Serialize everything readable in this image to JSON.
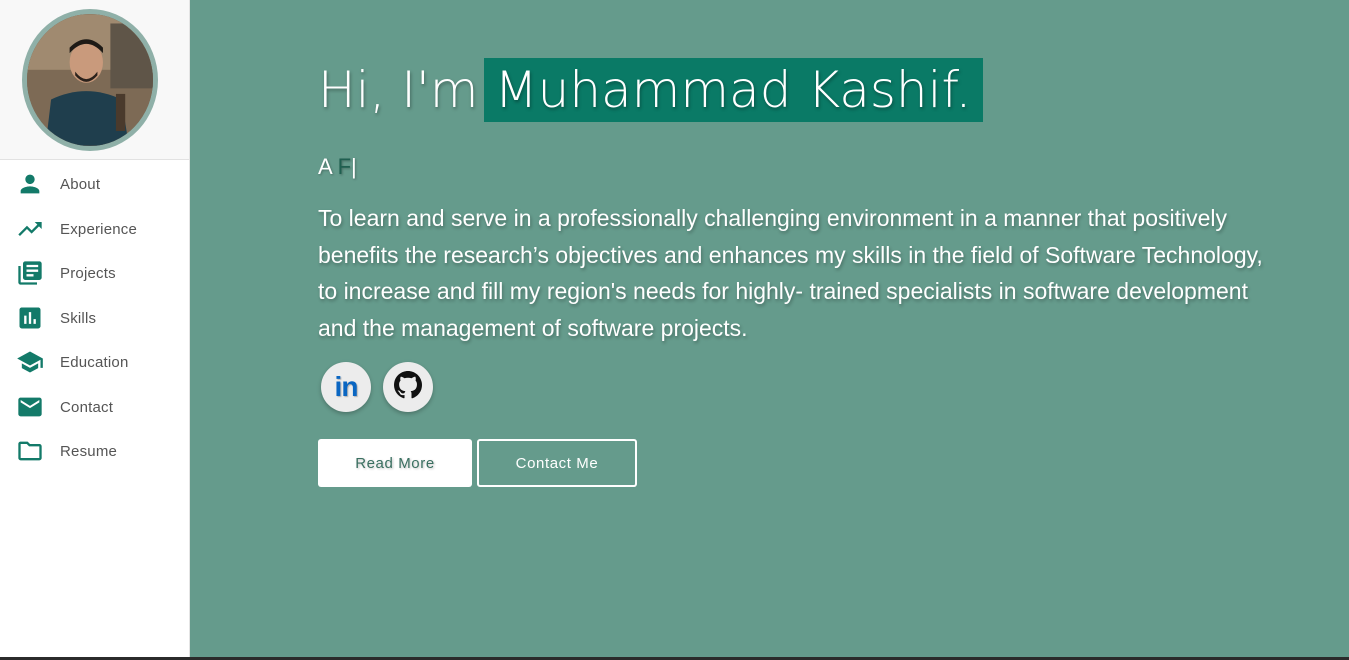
{
  "colors": {
    "accent": "#0a7a66",
    "main_background": "#659b8c",
    "nav_icon": "#137a69"
  },
  "sidebar": {
    "items": [
      {
        "label": "About",
        "icon": "person-icon"
      },
      {
        "label": "Experience",
        "icon": "trending-up-icon"
      },
      {
        "label": "Projects",
        "icon": "library-books-icon"
      },
      {
        "label": "Skills",
        "icon": "bar-chart-icon"
      },
      {
        "label": "Education",
        "icon": "school-icon"
      },
      {
        "label": "Contact",
        "icon": "mail-icon"
      },
      {
        "label": "Resume",
        "icon": "folder-icon"
      }
    ]
  },
  "hero": {
    "greeting": "Hi, I'm",
    "name": "Muhammad Kashif.",
    "typed_prefix": "A",
    "typed_text": "F",
    "caret": "|",
    "objective": "To learn and serve in a professionally challenging environment in a manner that positively benefits the research’s objectives and enhances my skills in the field of Software Technology, to increase and fill my region's needs for highly- trained specialists in software development and the management of software projects."
  },
  "social": {
    "linkedin_text": "in",
    "linkedin_icon": "linkedin-icon",
    "github_icon": "github-icon"
  },
  "buttons": {
    "read_more": "Read More",
    "contact_me": "Contact Me"
  }
}
